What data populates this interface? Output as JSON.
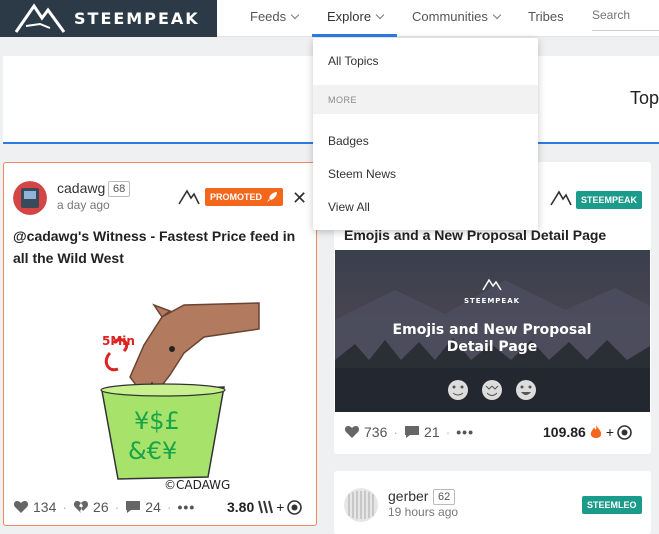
{
  "brand": {
    "name": "STEEMPEAK"
  },
  "nav": {
    "feeds": "Feeds",
    "explore": "Explore",
    "communities": "Communities",
    "tribes": "Tribes",
    "search_placeholder": "Search"
  },
  "band": {
    "title": "Top"
  },
  "dropdown": {
    "all_topics": "All Topics",
    "section": "MORE",
    "badges": "Badges",
    "steem_news": "Steem News",
    "view_all": "View All"
  },
  "cards": [
    {
      "author": "cadawg",
      "reputation": "68",
      "time": "a day ago",
      "tag": "PROMOTED",
      "title": "@cadawg's Witness - Fastest Price feed in all the Wild West",
      "image_text_top": "5Min",
      "image_signature": "©CADAWG",
      "votes": "134",
      "downvotes": "26",
      "comments": "24",
      "payout": "3.80"
    },
    {
      "tag": "STEEMPEAK",
      "title": "Emojis and a New Proposal Detail Page",
      "image_brand": "STEEMPEAK",
      "image_heading": "Emojis and New Proposal Detail Page",
      "votes": "736",
      "comments": "21",
      "payout": "109.86"
    },
    {
      "author": "gerber",
      "reputation": "62",
      "time": "19 hours ago",
      "tag": "STEEMLEO"
    }
  ],
  "colors": {
    "accent": "#2c7be5",
    "brand_bg": "#2c3a47",
    "promoted": "#f5661d",
    "tag_green": "#1b9b8a"
  }
}
